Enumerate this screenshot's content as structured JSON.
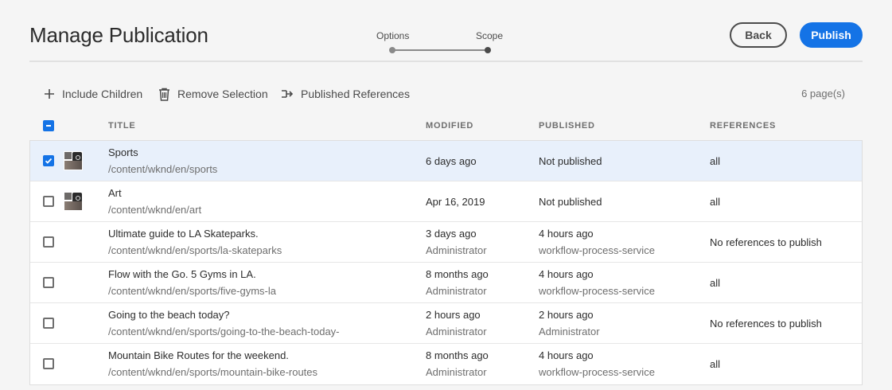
{
  "header": {
    "title": "Manage Publication",
    "wizard": {
      "steps": [
        "Options",
        "Scope"
      ],
      "current_step": "Scope"
    },
    "back_label": "Back",
    "publish_label": "Publish"
  },
  "actions": {
    "include_children": "Include Children",
    "remove_selection": "Remove Selection",
    "published_references": "Published References",
    "page_count": "6 page(s)"
  },
  "table": {
    "columns": {
      "title": "TITLE",
      "modified": "MODIFIED",
      "published": "PUBLISHED",
      "references": "REFERENCES"
    },
    "rows": [
      {
        "title": "Sports",
        "path": "/content/wknd/en/sports",
        "modified": "6 days ago",
        "modified_by": "",
        "published": "Not published",
        "published_by": "",
        "references": "all",
        "checked": true,
        "thumbnail": true
      },
      {
        "title": "Art",
        "path": "/content/wknd/en/art",
        "modified": "Apr 16, 2019",
        "modified_by": "",
        "published": "Not published",
        "published_by": "",
        "references": "all",
        "checked": false,
        "thumbnail": true
      },
      {
        "title": "Ultimate guide to LA Skateparks.",
        "path": "/content/wknd/en/sports/la-skateparks",
        "modified": "3 days ago",
        "modified_by": "Administrator",
        "published": "4 hours ago",
        "published_by": "workflow-process-service",
        "references": "No references to publish",
        "checked": false,
        "thumbnail": false
      },
      {
        "title": "Flow with the Go. 5 Gyms in LA.",
        "path": "/content/wknd/en/sports/five-gyms-la",
        "modified": "8 months ago",
        "modified_by": "Administrator",
        "published": "4 hours ago",
        "published_by": "workflow-process-service",
        "references": "all",
        "checked": false,
        "thumbnail": false
      },
      {
        "title": "Going to the beach today?",
        "path": "/content/wknd/en/sports/going-to-the-beach-today-",
        "modified": "2 hours ago",
        "modified_by": "Administrator",
        "published": "2 hours ago",
        "published_by": "Administrator",
        "references": "No references to publish",
        "checked": false,
        "thumbnail": false
      },
      {
        "title": "Mountain Bike Routes for the weekend.",
        "path": "/content/wknd/en/sports/mountain-bike-routes",
        "modified": "8 months ago",
        "modified_by": "Administrator",
        "published": "4 hours ago",
        "published_by": "workflow-process-service",
        "references": "all",
        "checked": false,
        "thumbnail": false
      }
    ]
  },
  "colors": {
    "accent": "#1473e6",
    "selected_row": "#e8f0fb"
  }
}
